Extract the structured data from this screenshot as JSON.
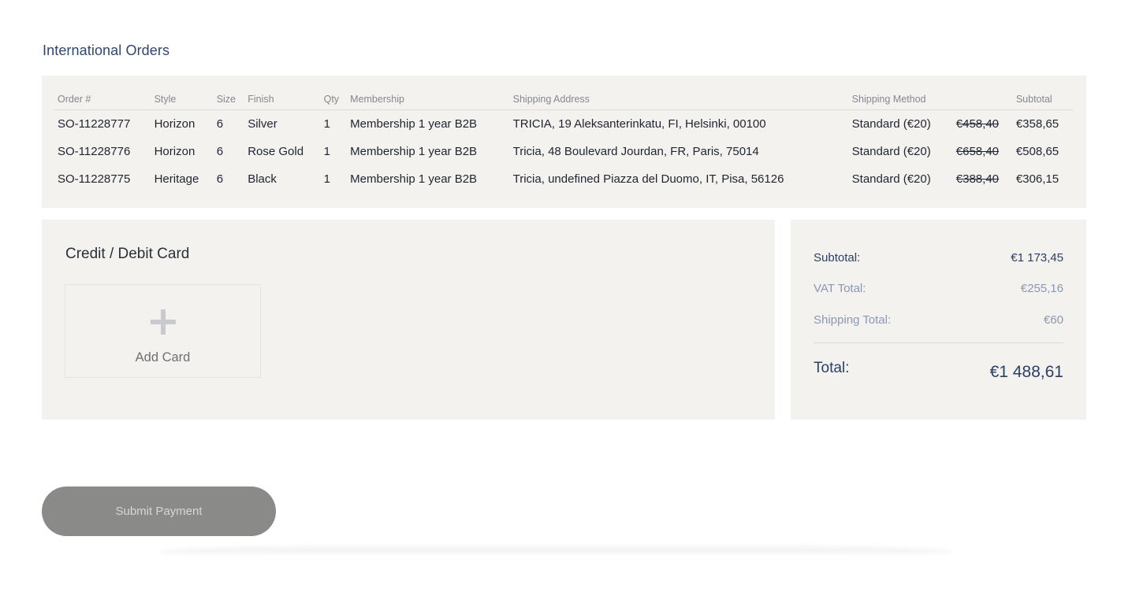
{
  "section_title": "International Orders",
  "orders": {
    "headers": [
      "Order #",
      "Style",
      "Size",
      "Finish",
      "Qty",
      "Membership",
      "Shipping Address",
      "Shipping Method",
      "",
      "Subtotal"
    ],
    "rows": [
      {
        "order": "SO-11228777",
        "style": "Horizon",
        "size": "6",
        "finish": "Silver",
        "qty": "1",
        "membership": "Membership 1 year B2B",
        "address": "TRICIA, 19 Aleksanterinkatu, FI, Helsinki, 00100",
        "method": "Standard (€20)",
        "original": "€458,40",
        "subtotal": "€358,65"
      },
      {
        "order": "SO-11228776",
        "style": "Horizon",
        "size": "6",
        "finish": "Rose Gold",
        "qty": "1",
        "membership": "Membership 1 year B2B",
        "address": "Tricia, 48 Boulevard Jourdan, FR, Paris, 75014",
        "method": "Standard (€20)",
        "original": "€658,40",
        "subtotal": "€508,65"
      },
      {
        "order": "SO-11228775",
        "style": "Heritage",
        "size": "6",
        "finish": "Black",
        "qty": "1",
        "membership": "Membership 1 year B2B",
        "address": "Tricia, undefined Piazza del Duomo, IT, Pisa, 56126",
        "method": "Standard (€20)",
        "original": "€388,40",
        "subtotal": "€306,15"
      }
    ]
  },
  "payment": {
    "title": "Credit / Debit Card",
    "add_card_label": "Add Card",
    "add_card_icon": "plus-icon"
  },
  "summary": {
    "subtotal_label": "Subtotal:",
    "subtotal_value": "€1 173,45",
    "vat_label": "VAT Total:",
    "vat_value": "€255,16",
    "shipping_label": "Shipping Total:",
    "shipping_value": "€60",
    "total_label": "Total:",
    "total_value": "€1 488,61"
  },
  "submit_label": "Submit Payment",
  "colors": {
    "heading": "#2f4770",
    "panel_bg": "#f3f2ef",
    "button_bg": "#8a8a89"
  }
}
